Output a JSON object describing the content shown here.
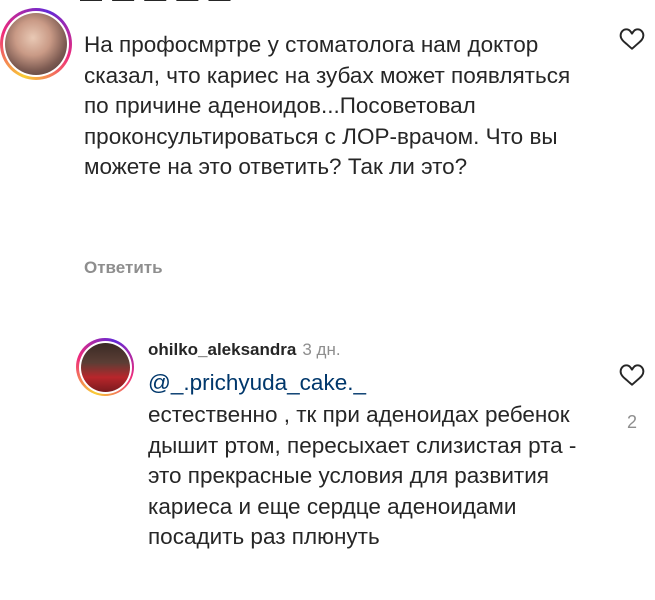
{
  "clipped_top_text": "— — — — —",
  "comment1": {
    "text": "На профосмртре у стоматолога нам доктор сказал, что кариес на зубах может появляться по причине аденоидов...Посоветовал проконсультироваться с ЛОР-врачом. Что вы можете на это ответить? Так ли это?",
    "reply_label": "Ответить"
  },
  "comment2": {
    "username": "ohilko_aleksandra",
    "timestamp": "3 дн.",
    "mention": "@_.prichyuda_cake._",
    "text": "естественно , тк при аденоидах ребенок дышит ртом, пересыхает слизистая рта - это прекрасные условия для развития кариеса и еще сердце аденоидами посадить раз плюнуть",
    "likes": "2"
  },
  "colors": {
    "text": "#262626",
    "secondary": "#8e8e8e",
    "mention": "#00376b",
    "story_ring": [
      "#f9ce34",
      "#ee2a7b",
      "#6228d7"
    ]
  },
  "icons": [
    "heart-outline-icon"
  ]
}
